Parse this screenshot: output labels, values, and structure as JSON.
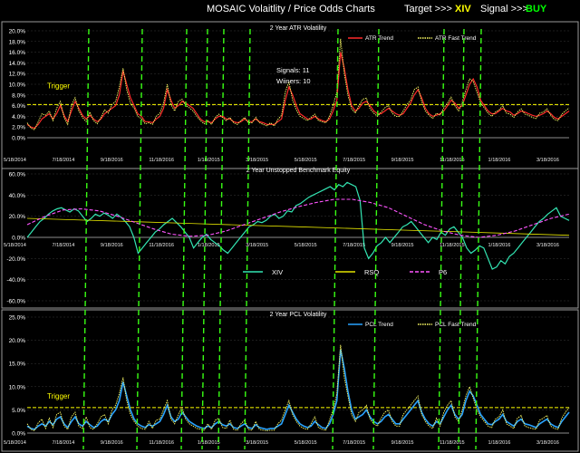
{
  "header": {
    "title": "MOSAIC  Volaitlity / Price Odds Charts",
    "target_label": "Target >>>",
    "target_value": "XIV",
    "signal_label": "Signal >>>",
    "signal_value": "BUY",
    "highlight_color": "#ffff00",
    "buy_color": "#00ff00"
  },
  "chart_data": [
    {
      "type": "line",
      "title": "2 Year  ATR  Volatility",
      "y_ticks": [
        "20.0%",
        "18.0%",
        "16.0%",
        "14.0%",
        "12.0%",
        "10.0%",
        "8.0%",
        "6.0%",
        "4.0%",
        "2.0%",
        "0.0%"
      ],
      "ylim": [
        0,
        20
      ],
      "x_ticks": [
        "5/18/2014",
        "7/18/2014",
        "9/18/2016",
        "11/18/2016",
        "1/18/2015",
        "3/18/2015",
        "5/18/2015",
        "7/18/2015",
        "9/18/2015",
        "11/18/2015",
        "1/18/2016",
        "3/18/2016"
      ],
      "legend": [
        "ATR Trend",
        "ATR Fast Trend"
      ],
      "legend_position": "top-right",
      "trigger_label": "Trigger",
      "trigger_value": 6.2,
      "annotations": [
        "Signals: 11",
        "Wiiners: 10"
      ],
      "series": [
        {
          "name": "ATR Trend",
          "color": "#ff2a2a",
          "values": [
            2.5,
            2,
            1.8,
            2.5,
            3.5,
            4,
            4.5,
            3.5,
            4.5,
            6,
            4.2,
            3,
            5,
            6.8,
            5.5,
            4.2,
            3.5,
            4.2,
            3.5,
            3,
            3.5,
            4.5,
            5,
            5.5,
            6,
            8,
            12.5,
            10,
            7.5,
            6,
            4.5,
            4,
            3,
            3,
            2.8,
            3.5,
            4,
            5.5,
            9,
            7,
            5.5,
            6,
            6.8,
            6.5,
            6,
            5.5,
            4.5,
            3.5,
            3,
            3,
            2.8,
            3.5,
            4,
            4,
            3.5,
            3.5,
            3,
            2.8,
            3,
            3.5,
            3,
            3,
            3.5,
            3,
            2.8,
            2.5,
            2.5,
            2.5,
            3,
            3.5,
            7,
            9.5,
            8,
            6,
            4.5,
            4,
            3.5,
            3.5,
            4,
            3.5,
            3.2,
            3,
            3.5,
            5,
            7,
            16,
            13,
            9,
            6,
            5,
            5.5,
            6.5,
            6.8,
            6,
            5,
            4.5,
            4.5,
            5,
            5.5,
            5,
            4.5,
            4.2,
            4.5,
            5.5,
            6.5,
            8,
            9,
            7.5,
            5.5,
            4.5,
            4,
            4.2,
            4.5,
            5,
            6,
            7,
            6.5,
            5.5,
            6,
            8,
            10,
            11,
            9.5,
            7,
            6,
            5,
            4.5,
            4.5,
            5,
            5.5,
            5,
            4.8,
            4.2,
            4.5,
            5,
            4.8,
            4.5,
            4.2,
            4,
            4.2,
            4.5,
            5,
            4.5,
            3.8,
            3.5,
            4,
            4.5,
            5
          ]
        },
        {
          "name": "ATR Fast Trend",
          "color": "#ffff66",
          "values": [
            2.8,
            1.8,
            1.5,
            3,
            4.5,
            4.2,
            5,
            3.2,
            5.5,
            6.8,
            3.8,
            2.5,
            6,
            7.5,
            5,
            3.8,
            3,
            4.8,
            3.2,
            2.6,
            3.8,
            5.2,
            4.6,
            6.2,
            6.8,
            9.5,
            13,
            9,
            6.5,
            5.5,
            4,
            3.6,
            2.6,
            2.8,
            2.5,
            4,
            4.6,
            6.5,
            10,
            6.2,
            5,
            6.8,
            7.2,
            6,
            5.6,
            5,
            4,
            3.2,
            2.6,
            3.2,
            2.5,
            3.8,
            4.4,
            3.8,
            3.2,
            3.8,
            2.8,
            2.5,
            3.2,
            3.8,
            2.8,
            2.8,
            3.8,
            2.8,
            2.5,
            2.2,
            2.8,
            2.2,
            3.4,
            4.2,
            8.5,
            10.5,
            7,
            5.2,
            4,
            3.6,
            3.2,
            3.8,
            4.4,
            3.2,
            3,
            2.8,
            4,
            6,
            8.5,
            18.5,
            12,
            8,
            5.4,
            4.6,
            6,
            7.2,
            7.4,
            5.4,
            4.6,
            4,
            4.8,
            5.6,
            6,
            4.6,
            4,
            4,
            5,
            6.2,
            7,
            9,
            9.5,
            6.8,
            5,
            4.2,
            3.6,
            4.6,
            4.2,
            5.6,
            6.5,
            7.6,
            6,
            5,
            6.6,
            9,
            11,
            10.5,
            8.5,
            6.5,
            5.6,
            4.6,
            4,
            4.8,
            5.2,
            6,
            4.6,
            4.4,
            3.8,
            4.8,
            5.4,
            4.4,
            4.2,
            3.8,
            3.6,
            4.6,
            4.8,
            5.4,
            4.2,
            3.4,
            3.2,
            4.4,
            5,
            5.6
          ]
        }
      ]
    },
    {
      "type": "line",
      "title": "2 Year  Unstopped Benchmark  Equity",
      "y_ticks": [
        "60.0%",
        "40.0%",
        "20.0%",
        "0.0%",
        "-20.0%",
        "-40.0%",
        "-60.0%"
      ],
      "ylim": [
        -60,
        60
      ],
      "x_ticks": [
        "5/18/2014",
        "7/18/2014",
        "9/18/2016",
        "11/18/2016",
        "1/18/2015",
        "3/18/2015",
        "5/18/2015",
        "7/18/2015",
        "9/18/2015",
        "11/18/2015",
        "1/18/2016",
        "3/18/2016"
      ],
      "legend": [
        "XIV",
        "RSQ",
        "P6"
      ],
      "legend_position": "bottom-center",
      "series": [
        {
          "name": "XIV",
          "color": "#33e6b3",
          "values": [
            0,
            5,
            10,
            15,
            18,
            22,
            25,
            27,
            28,
            26,
            24,
            27,
            25,
            20,
            15,
            18,
            22,
            20,
            23,
            21,
            18,
            22,
            19,
            15,
            10,
            0,
            -15,
            -10,
            -5,
            0,
            5,
            8,
            12,
            15,
            18,
            14,
            10,
            5,
            0,
            -10,
            -5,
            0,
            3,
            -2,
            -5,
            -8,
            -12,
            -15,
            -10,
            -5,
            0,
            5,
            10,
            12,
            15,
            14,
            16,
            20,
            22,
            18,
            20,
            25,
            24,
            30,
            32,
            35,
            38,
            40,
            42,
            44,
            46,
            48,
            45,
            50,
            48,
            52,
            50,
            48,
            35,
            -10,
            -20,
            -15,
            -8,
            -5,
            0,
            -5,
            0,
            5,
            10,
            12,
            15,
            10,
            5,
            0,
            -5,
            0,
            -2,
            5,
            2,
            8,
            10,
            5,
            0,
            -10,
            -15,
            -12,
            -8,
            -10,
            -20,
            -30,
            -28,
            -22,
            -25,
            -18,
            -15,
            -10,
            -5,
            0,
            5,
            10,
            15,
            18,
            22,
            25,
            28,
            20,
            18,
            16
          ]
        },
        {
          "name": "RSQ",
          "color": "#e6e600",
          "values": [
            18,
            16.4,
            14.8,
            13.2,
            11.6,
            10,
            8.4,
            6.8,
            5.2,
            3.6,
            2
          ]
        },
        {
          "name": "P6",
          "color": "#ff55ff",
          "values": [
            12,
            20,
            26,
            27,
            25,
            20,
            14,
            8,
            3,
            1,
            2,
            6,
            12,
            18,
            24,
            29,
            33,
            36,
            36,
            33,
            28,
            20,
            12,
            6,
            2,
            0,
            2,
            6,
            12,
            18,
            22
          ]
        }
      ]
    },
    {
      "type": "line",
      "title": "2 Year  PCL  Volatility",
      "y_ticks": [
        "25.0%",
        "20.0%",
        "15.0%",
        "10.0%",
        "5.0%",
        "0.0%"
      ],
      "ylim": [
        0,
        25
      ],
      "x_ticks": [
        "5/18/2014",
        "7/18/2014",
        "9/18/2016",
        "11/18/2016",
        "1/18/2015",
        "3/18/2015",
        "5/18/2015",
        "7/18/2015",
        "9/18/2015",
        "11/18/2015",
        "1/18/2016",
        "3/18/2016"
      ],
      "legend": [
        "PCL Trend",
        "PCL Fast Trend"
      ],
      "legend_position": "top-right",
      "trigger_label": "Trigger",
      "trigger_value": 5.5,
      "series": [
        {
          "name": "PCL Trend",
          "color": "#29a3ff",
          "values": [
            1.5,
            1,
            0.8,
            1.5,
            2,
            1.5,
            2.5,
            1.8,
            3,
            3.5,
            2,
            1.2,
            2.5,
            3.5,
            2,
            1.5,
            2.5,
            1.8,
            1.2,
            1.5,
            2.5,
            3,
            2.5,
            4,
            5,
            7,
            11,
            8,
            5,
            3,
            2,
            1.5,
            1.2,
            1.8,
            1.5,
            2,
            2.5,
            4,
            6,
            3.5,
            2.5,
            3,
            4.5,
            3.5,
            2.5,
            2,
            1.5,
            1.2,
            1,
            1.5,
            1.2,
            2,
            2.5,
            1.8,
            1.5,
            2,
            1.2,
            1,
            1.5,
            2,
            1.2,
            1,
            1.8,
            1.2,
            1,
            0.8,
            1,
            1,
            1.5,
            2,
            4,
            6,
            4.5,
            3,
            2,
            1.5,
            1.2,
            1.5,
            2.5,
            1.8,
            1.2,
            1,
            2,
            4,
            7,
            18,
            14,
            9,
            5,
            3,
            3.5,
            4,
            5,
            3.5,
            2.5,
            2,
            2.5,
            3.5,
            4,
            3,
            2,
            2,
            3,
            4,
            5,
            6,
            7,
            4.5,
            3,
            2,
            1.5,
            2.5,
            2,
            3.5,
            5,
            6,
            4,
            3,
            4,
            7,
            9,
            8,
            6,
            4,
            3,
            2,
            1.8,
            2.5,
            3,
            4,
            2.5,
            2,
            1.5,
            2.5,
            3,
            2,
            1.8,
            1.5,
            1.2,
            2,
            2.5,
            3,
            2,
            1.5,
            1.2,
            2.5,
            3.5,
            4.5
          ]
        },
        {
          "name": "PCL Fast Trend",
          "color": "#ffff66",
          "values": [
            2,
            0.8,
            0.5,
            2.2,
            3,
            1,
            3.2,
            1.2,
            4,
            4.5,
            1.5,
            0.8,
            3.5,
            4.5,
            1.5,
            1,
            3.5,
            1.2,
            0.8,
            2,
            3.5,
            4,
            2,
            5,
            6,
            8.5,
            12,
            7,
            4,
            2.5,
            1.5,
            1,
            0.8,
            2.5,
            1,
            2.8,
            3,
            5,
            7,
            3,
            2,
            4,
            5.5,
            3,
            2,
            1.5,
            1,
            0.8,
            0.6,
            2,
            0.8,
            2.8,
            3.2,
            1.2,
            1,
            2.8,
            0.8,
            0.6,
            2,
            2.8,
            0.8,
            0.6,
            2.5,
            0.8,
            0.6,
            0.5,
            0.6,
            0.6,
            2,
            2.8,
            5,
            7,
            4,
            2.5,
            1.5,
            1,
            0.8,
            2,
            3.5,
            1.2,
            0.8,
            0.6,
            2.8,
            5,
            8.5,
            19,
            12,
            8,
            4,
            2.5,
            4.5,
            5,
            6,
            3,
            2,
            1.5,
            3.2,
            4.5,
            5,
            2.5,
            1.5,
            1.5,
            4,
            5,
            6,
            7,
            8,
            4,
            2.5,
            1.5,
            1,
            3.2,
            1.5,
            4.5,
            6,
            7,
            3.5,
            2.5,
            5,
            8,
            10,
            7.5,
            5,
            3.5,
            2.5,
            1.5,
            1.2,
            3,
            3.5,
            5,
            2,
            1.5,
            1,
            3.2,
            3.8,
            1.5,
            1.2,
            1,
            0.8,
            2.8,
            3.2,
            3.8,
            1.5,
            1,
            0.8,
            3.2,
            4.5,
            5.5
          ]
        }
      ]
    }
  ]
}
